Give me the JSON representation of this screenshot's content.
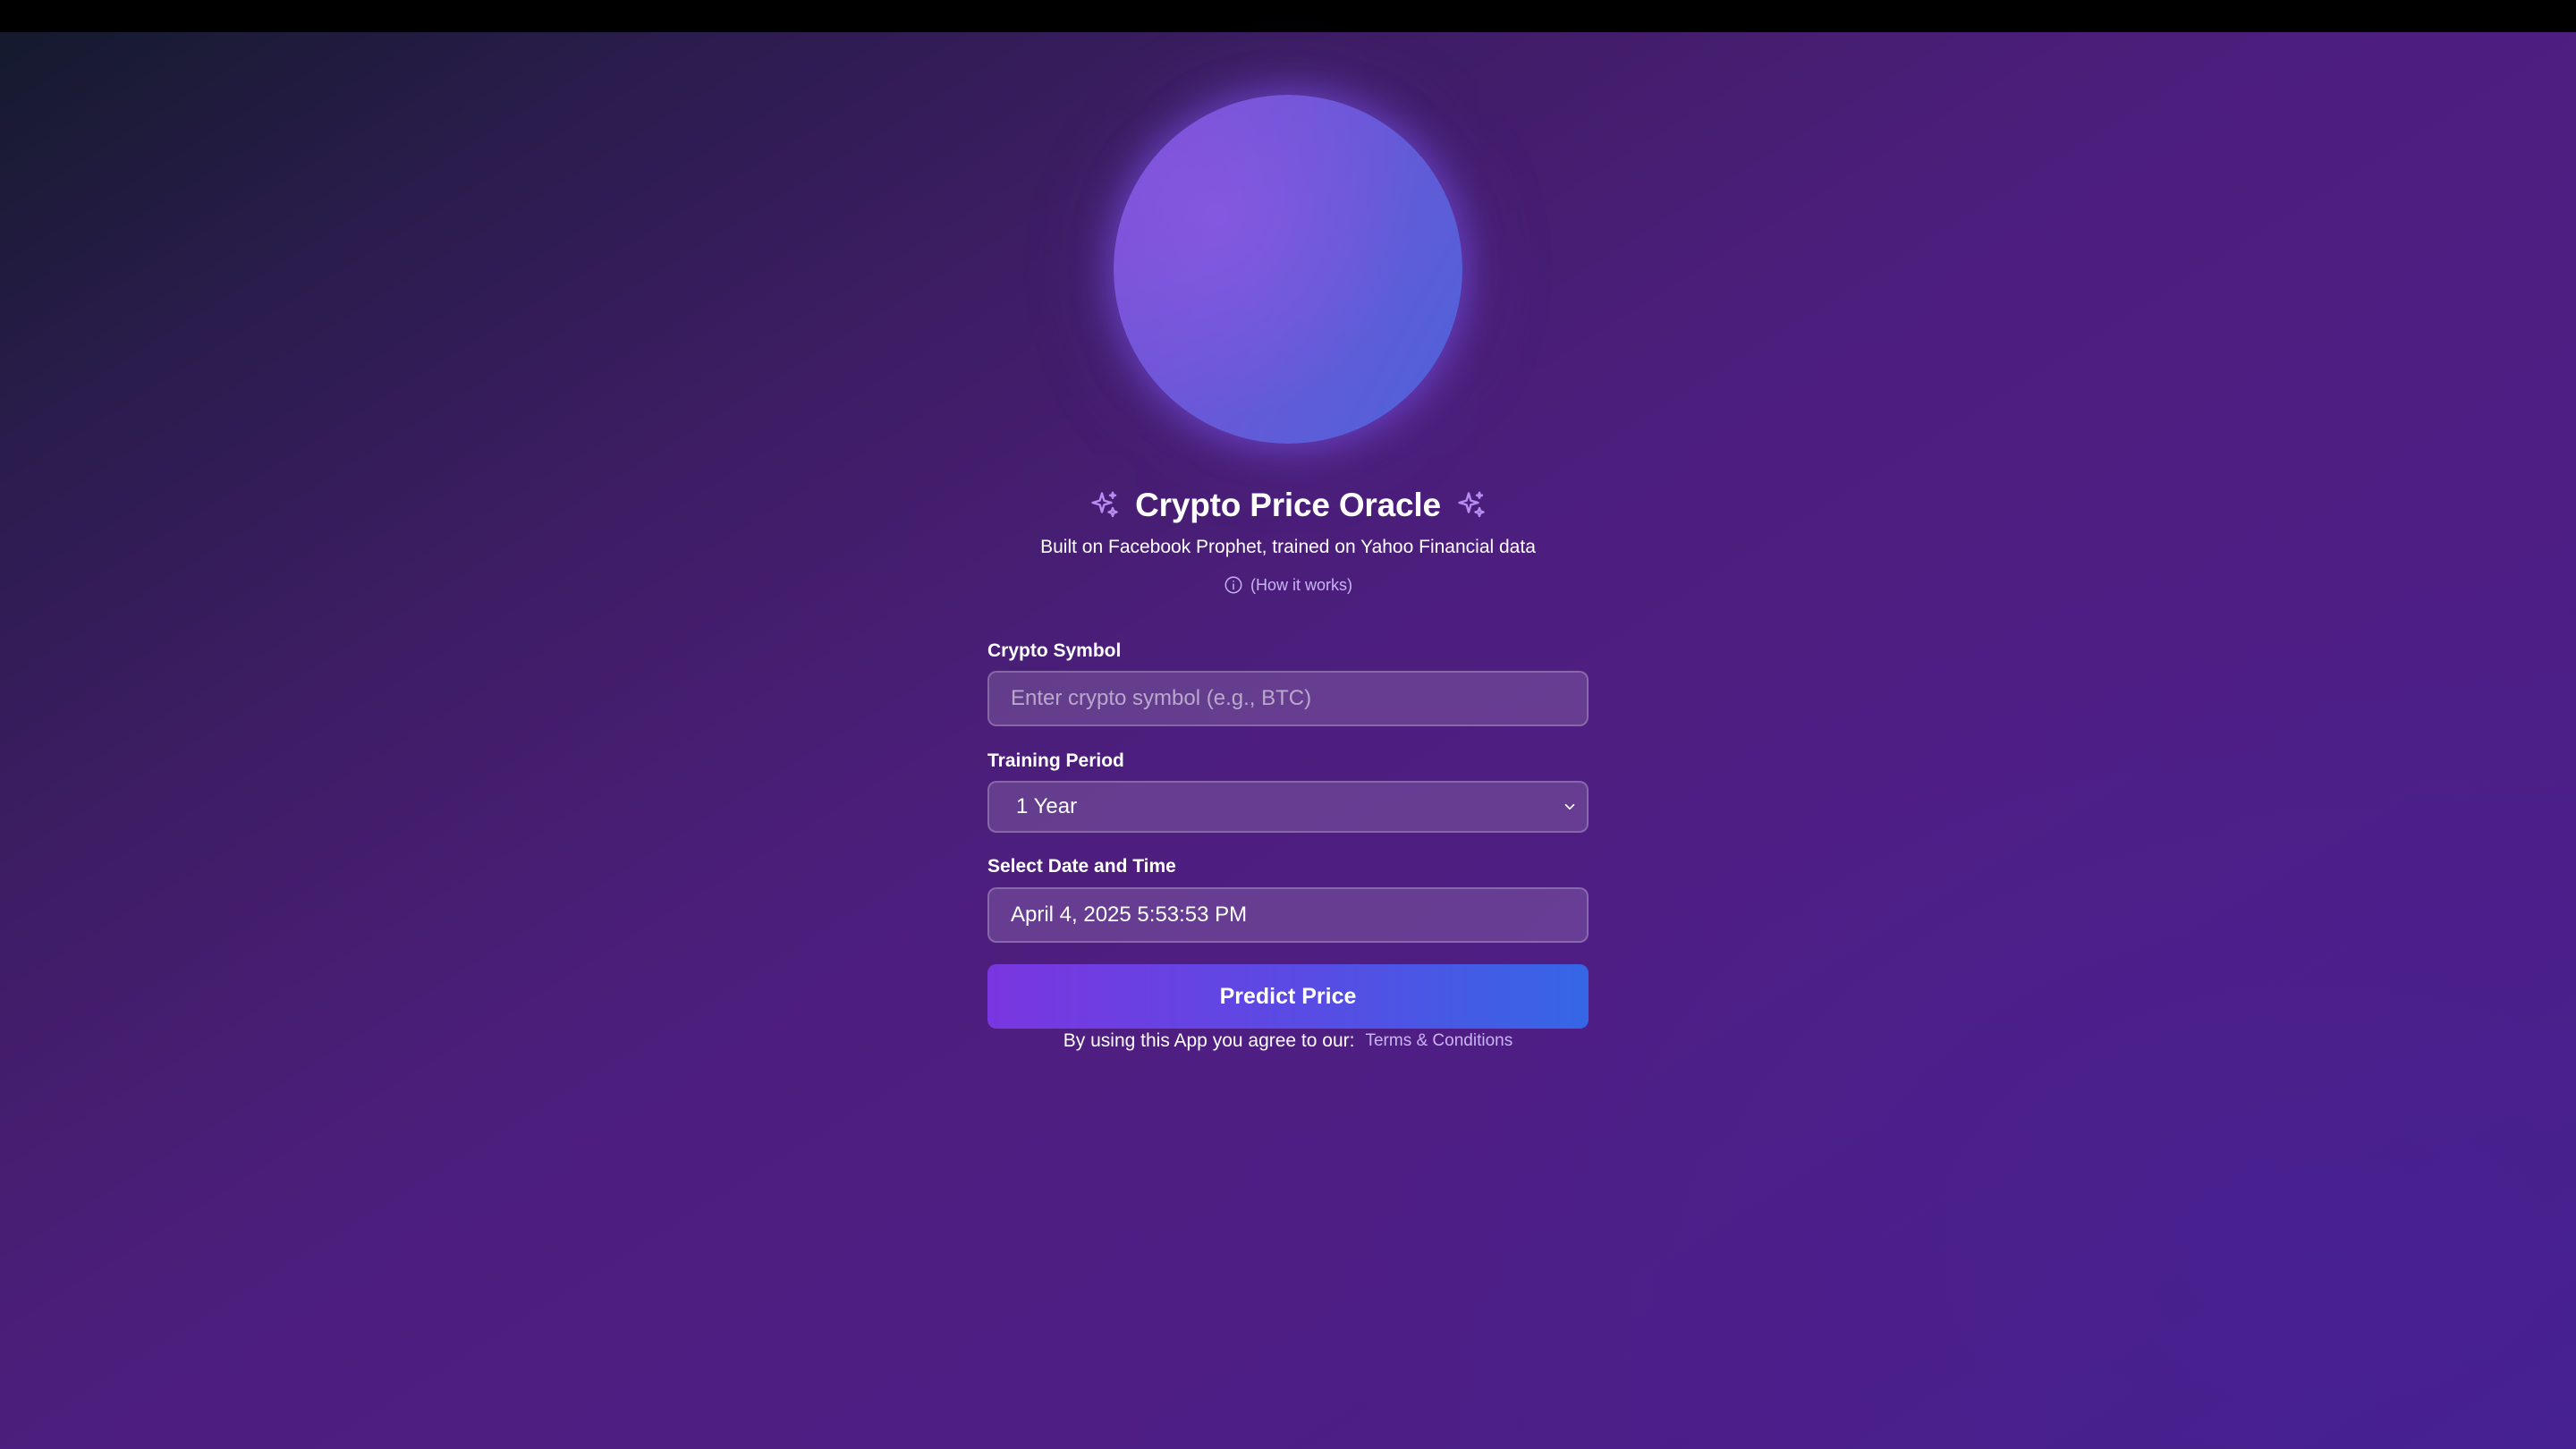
{
  "header": {
    "title": "Crypto Price Oracle",
    "subtitle": "Built on Facebook Prophet, trained on Yahoo Financial data",
    "how_it_works": "(How it works)"
  },
  "form": {
    "symbol": {
      "label": "Crypto Symbol",
      "placeholder": "Enter crypto symbol (e.g., BTC)",
      "value": ""
    },
    "training_period": {
      "label": "Training Period",
      "selected": "1 Year"
    },
    "datetime": {
      "label": "Select Date and Time",
      "value": "April 4, 2025 5:53:53 PM"
    },
    "submit_label": "Predict Price"
  },
  "footer": {
    "agree_text": "By using this App you agree to our:",
    "terms_link": "Terms & Conditions"
  },
  "icons": {
    "title_left": "sparkles-icon",
    "title_right": "sparkles-icon",
    "info": "info-icon",
    "select_chevron": "chevron-down-icon"
  },
  "colors": {
    "accent_purple": "#7a36e0",
    "accent_blue": "#3566e6",
    "link": "#c9b5f5",
    "orb": "#6a58d8"
  }
}
